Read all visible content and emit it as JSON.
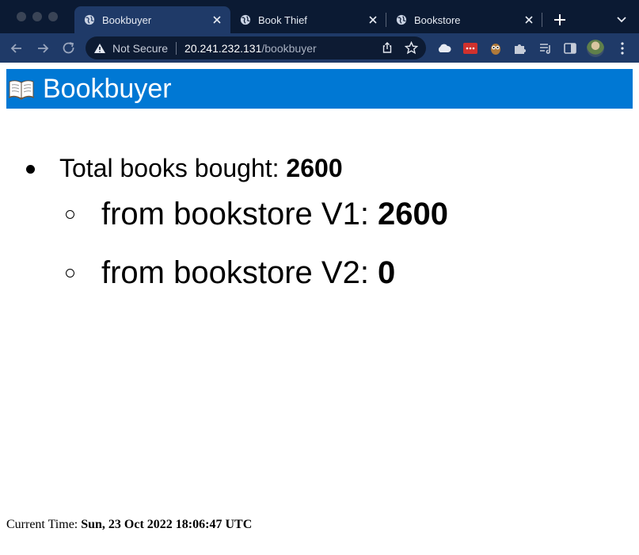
{
  "browser": {
    "tabs": [
      {
        "title": "Bookbuyer",
        "active": true
      },
      {
        "title": "Book Thief",
        "active": false
      },
      {
        "title": "Bookstore",
        "active": false
      }
    ],
    "address": {
      "security_label": "Not Secure",
      "host": "20.241.232.131",
      "path": "/bookbuyer"
    },
    "icons": {
      "back": "back-arrow-icon",
      "forward": "forward-arrow-icon",
      "reload": "reload-icon",
      "new_tab": "plus-icon"
    }
  },
  "page": {
    "title": "Bookbuyer",
    "header_color": "#0078d4",
    "stats": {
      "total_label": "Total books bought: ",
      "total_value": "2600",
      "v1_label": "from bookstore V1: ",
      "v1_value": "2600",
      "v2_label": "from bookstore V2: ",
      "v2_value": "0"
    },
    "footer": {
      "label": "Current Time: ",
      "value": "Sun, 23 Oct 2022 18:06:47 UTC"
    }
  }
}
